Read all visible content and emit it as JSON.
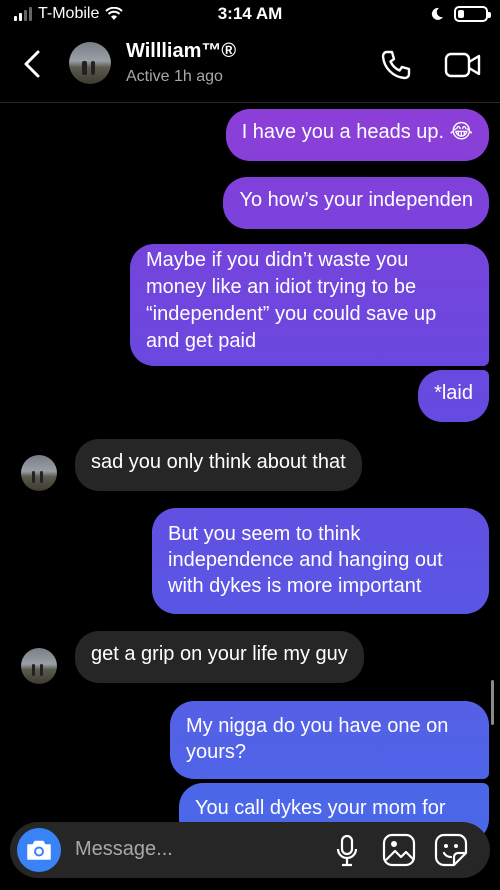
{
  "status_bar": {
    "carrier": "T-Mobile",
    "time": "3:14 AM"
  },
  "header": {
    "name": "Willliam™®",
    "active": "Active 1h ago"
  },
  "messages": [
    {
      "from": "me",
      "text": "I have you a heads up. 😂"
    },
    {
      "from": "me",
      "text": "Yo how’s your independen"
    },
    {
      "from": "me",
      "text": "Maybe if you didn’t waste you\nmoney like an idiot trying to be\n“independent” you could save up\nand get paid"
    },
    {
      "from": "me",
      "text": "*laid"
    },
    {
      "from": "them",
      "text": "sad you only think about that"
    },
    {
      "from": "me",
      "text": "But you seem to think\nindependence and hanging out\nwith dykes is more important"
    },
    {
      "from": "them",
      "text": "get a grip on your life my guy"
    },
    {
      "from": "me",
      "text": "My nigga do you have one on\nyours?"
    },
    {
      "from": "me",
      "text": "You call dykes your mom for"
    }
  ],
  "composer": {
    "placeholder": "Message..."
  },
  "colors": {
    "bubble_top": "#8a3fd6",
    "bubble_bottom": "#4f60e6",
    "incoming": "#262626",
    "camera": "#3a82f7"
  },
  "icons": [
    "back-chevron-icon",
    "phone-icon",
    "video-icon",
    "camera-icon",
    "microphone-icon",
    "gallery-icon",
    "sticker-icon",
    "wifi-icon",
    "moon-icon",
    "battery-icon"
  ]
}
